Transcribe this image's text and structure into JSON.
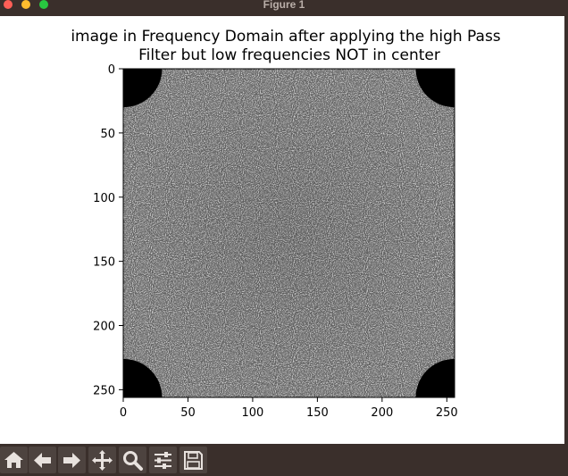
{
  "window": {
    "title": "Figure 1"
  },
  "figure": {
    "title_line1": "image in Frequency Domain after applying the high Pass",
    "title_line2": "Filter but low frequencies NOT in center"
  },
  "chart_data": {
    "type": "heatmap",
    "title": "image in Frequency Domain after applying the high Pass Filter but low frequencies NOT in center",
    "xlabel": "",
    "ylabel": "",
    "xlim": [
      0,
      256
    ],
    "ylim": [
      256,
      0
    ],
    "x_ticks": [
      0,
      50,
      100,
      150,
      200,
      250
    ],
    "y_ticks": [
      0,
      50,
      100,
      150,
      200,
      250
    ],
    "image_size": [
      256,
      256
    ],
    "colormap": "gray",
    "mask": {
      "shape": "circle",
      "radius": 30,
      "value": 0,
      "centers": [
        [
          0,
          0
        ],
        [
          256,
          0
        ],
        [
          0,
          256
        ],
        [
          256,
          256
        ]
      ]
    },
    "grid": false
  },
  "toolbar": {
    "items": [
      {
        "name": "home-button",
        "icon": "home-icon"
      },
      {
        "name": "back-button",
        "icon": "arrow-left-icon"
      },
      {
        "name": "forward-button",
        "icon": "arrow-right-icon"
      },
      {
        "name": "pan-button",
        "icon": "move-icon"
      },
      {
        "name": "zoom-button",
        "icon": "magnifier-icon"
      },
      {
        "name": "subplots-button",
        "icon": "sliders-icon"
      },
      {
        "name": "save-button",
        "icon": "floppy-icon"
      }
    ]
  },
  "colors": {
    "window_bg": "#3a2f2b",
    "canvas_bg": "#ffffff",
    "button_bg": "#4d433f",
    "close": "#ff5f57",
    "minimize": "#febc2e",
    "maximize": "#28c840"
  }
}
